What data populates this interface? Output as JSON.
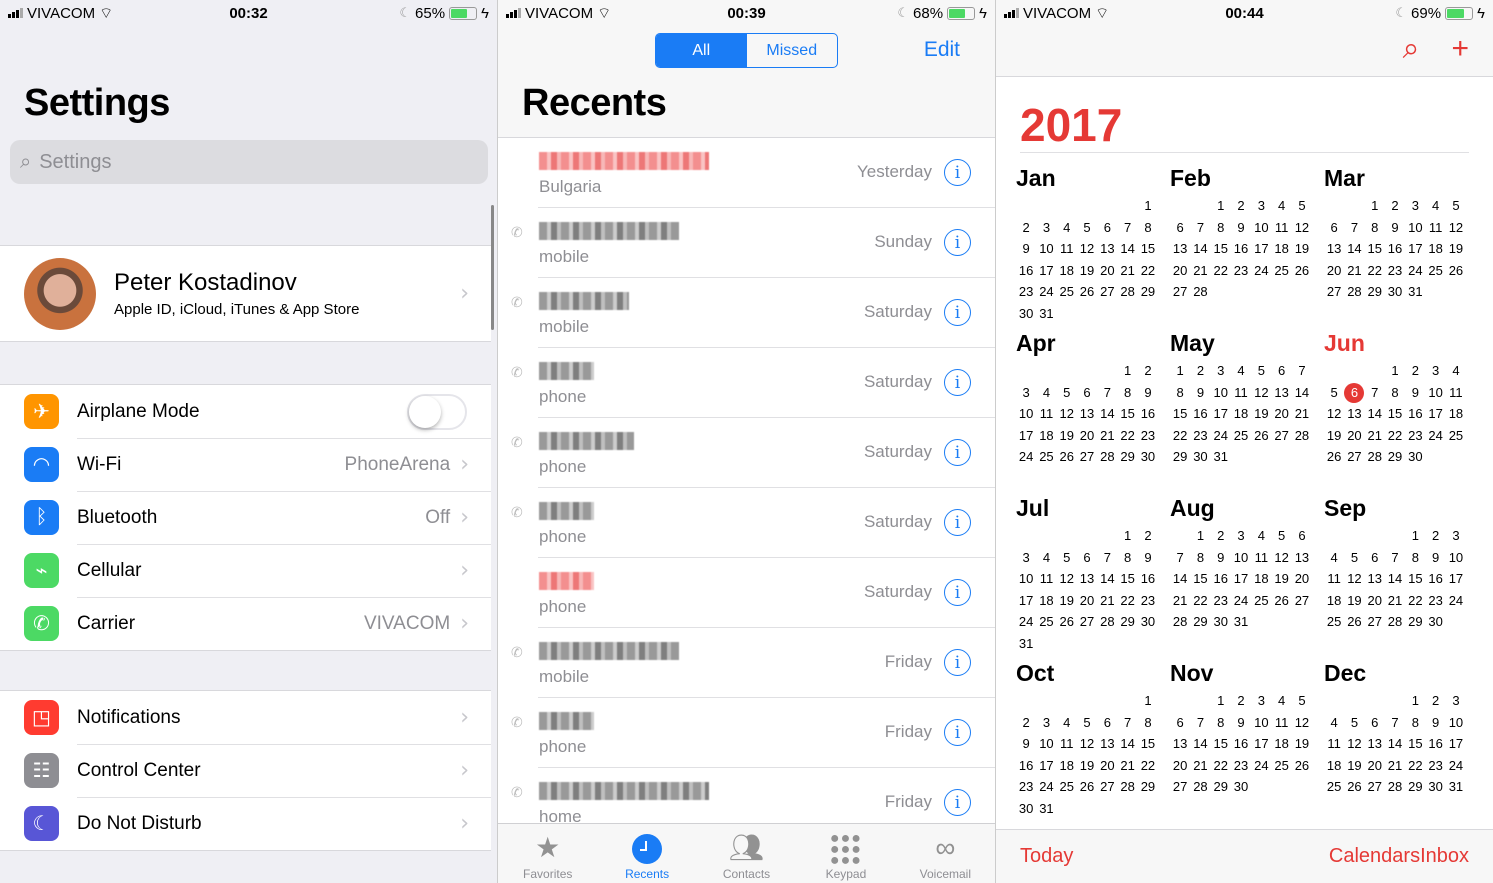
{
  "colors": {
    "ios_blue": "#1a7cf5",
    "calendar_red": "#e53935",
    "switch_off": "#ffffff",
    "battery_green": "#4cd964"
  },
  "screens": [
    {
      "status": {
        "carrier": "VIVACOM",
        "time": "00:32",
        "battery": "65%",
        "battery_level": 0.65
      }
    },
    {
      "status": {
        "carrier": "VIVACOM",
        "time": "00:39",
        "battery": "68%",
        "battery_level": 0.68
      }
    },
    {
      "status": {
        "carrier": "VIVACOM",
        "time": "00:44",
        "battery": "69%",
        "battery_level": 0.69
      }
    }
  ],
  "settings": {
    "title": "Settings",
    "search_placeholder": "Settings",
    "profile": {
      "name": "Peter Kostadinov",
      "subtitle": "Apple ID, iCloud, iTunes & App Store"
    },
    "groups": [
      [
        {
          "icon": "airplane-icon",
          "label": "Airplane Mode",
          "value": "",
          "toggle": false,
          "color": "#ff9500"
        },
        {
          "icon": "wifi-icon",
          "label": "Wi-Fi",
          "value": "PhoneArena",
          "color": "#1a7cf5"
        },
        {
          "icon": "bluetooth-icon",
          "label": "Bluetooth",
          "value": "Off",
          "color": "#1a7cf5"
        },
        {
          "icon": "cellular-icon",
          "label": "Cellular",
          "value": "",
          "color": "#4cd964"
        },
        {
          "icon": "phone-icon",
          "label": "Carrier",
          "value": "VIVACOM",
          "color": "#4cd964"
        }
      ],
      [
        {
          "icon": "notifications-icon",
          "label": "Notifications",
          "value": "",
          "color": "#ff3b30"
        },
        {
          "icon": "control-center-icon",
          "label": "Control Center",
          "value": "",
          "color": "#8e8e93"
        },
        {
          "icon": "moon-icon",
          "label": "Do Not Disturb",
          "value": "",
          "color": "#5856d6"
        }
      ]
    ]
  },
  "recents": {
    "title": "Recents",
    "segments": [
      "All",
      "Missed"
    ],
    "selected_segment": "All",
    "edit_label": "Edit",
    "calls": [
      {
        "name": "(redacted)",
        "type": "Bulgaria",
        "when": "Yesterday",
        "missed": true,
        "outgoing": false
      },
      {
        "name": "(redacted)",
        "type": "mobile",
        "when": "Sunday",
        "missed": false,
        "outgoing": true
      },
      {
        "name": "(redacted)",
        "type": "mobile",
        "when": "Saturday",
        "missed": false,
        "outgoing": true
      },
      {
        "name": "(redacted)",
        "type": "phone",
        "when": "Saturday",
        "missed": false,
        "outgoing": true
      },
      {
        "name": "(redacted)",
        "type": "phone",
        "when": "Saturday",
        "missed": false,
        "outgoing": true
      },
      {
        "name": "(redacted)",
        "type": "phone",
        "when": "Saturday",
        "missed": false,
        "outgoing": true
      },
      {
        "name": "(redacted)",
        "type": "phone",
        "when": "Saturday",
        "missed": true,
        "outgoing": false
      },
      {
        "name": "(redacted)",
        "type": "mobile",
        "when": "Friday",
        "missed": false,
        "outgoing": true
      },
      {
        "name": "(redacted)",
        "type": "phone",
        "when": "Friday",
        "missed": false,
        "outgoing": true
      },
      {
        "name": "(redacted)",
        "type": "home",
        "when": "Friday",
        "missed": false,
        "outgoing": true
      }
    ],
    "tabs": [
      {
        "label": "Favorites",
        "icon": "star-icon"
      },
      {
        "label": "Recents",
        "icon": "clock-icon",
        "active": true
      },
      {
        "label": "Contacts",
        "icon": "contacts-icon"
      },
      {
        "label": "Keypad",
        "icon": "keypad-icon"
      },
      {
        "label": "Voicemail",
        "icon": "voicemail-icon"
      }
    ]
  },
  "calendar": {
    "year": "2017",
    "week_start": "Monday",
    "today": {
      "month": "Jun",
      "day": 6
    },
    "months": [
      "Jan",
      "Feb",
      "Mar",
      "Apr",
      "May",
      "Jun",
      "Jul",
      "Aug",
      "Sep",
      "Oct",
      "Nov",
      "Dec"
    ],
    "footer": {
      "left": "Today",
      "right": "CalendarsInbox"
    }
  }
}
